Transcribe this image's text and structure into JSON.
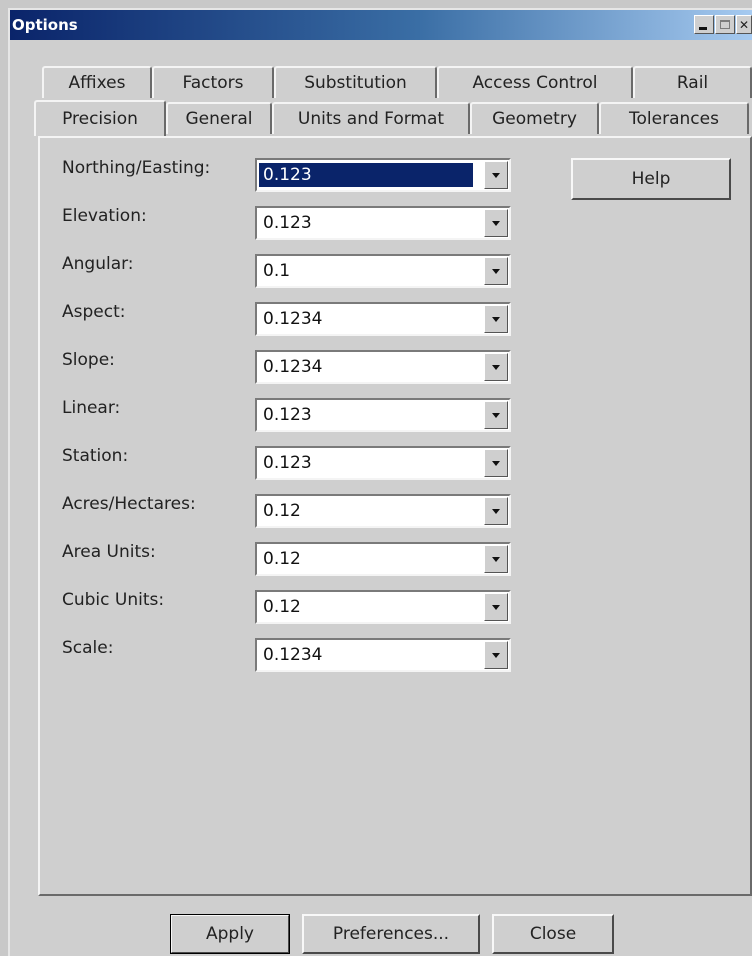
{
  "window": {
    "title": "Options"
  },
  "tabs": {
    "back_row": [
      "Affixes",
      "Factors",
      "Substitution",
      "Access Control",
      "Rail"
    ],
    "front_row": [
      "Precision",
      "General",
      "Units and Format",
      "Geometry",
      "Tolerances"
    ],
    "active": "Precision"
  },
  "fields": [
    {
      "label": "Northing/Easting:",
      "value": "0.123"
    },
    {
      "label": "Elevation:",
      "value": "0.123"
    },
    {
      "label": "Angular:",
      "value": "0.1"
    },
    {
      "label": "Aspect:",
      "value": "0.1234"
    },
    {
      "label": "Slope:",
      "value": "0.1234"
    },
    {
      "label": "Linear:",
      "value": "0.123"
    },
    {
      "label": "Station:",
      "value": "0.123"
    },
    {
      "label": "Acres/Hectares:",
      "value": "0.12"
    },
    {
      "label": "Area Units:",
      "value": "0.12"
    },
    {
      "label": "Cubic Units:",
      "value": "0.12"
    },
    {
      "label": "Scale:",
      "value": "0.1234"
    }
  ],
  "buttons": {
    "help": "Help",
    "apply": "Apply",
    "preferences": "Preferences...",
    "close": "Close"
  },
  "colors": {
    "title_bar": "#0a246a",
    "selection": "#0a246a",
    "face": "#cfcfcf"
  }
}
